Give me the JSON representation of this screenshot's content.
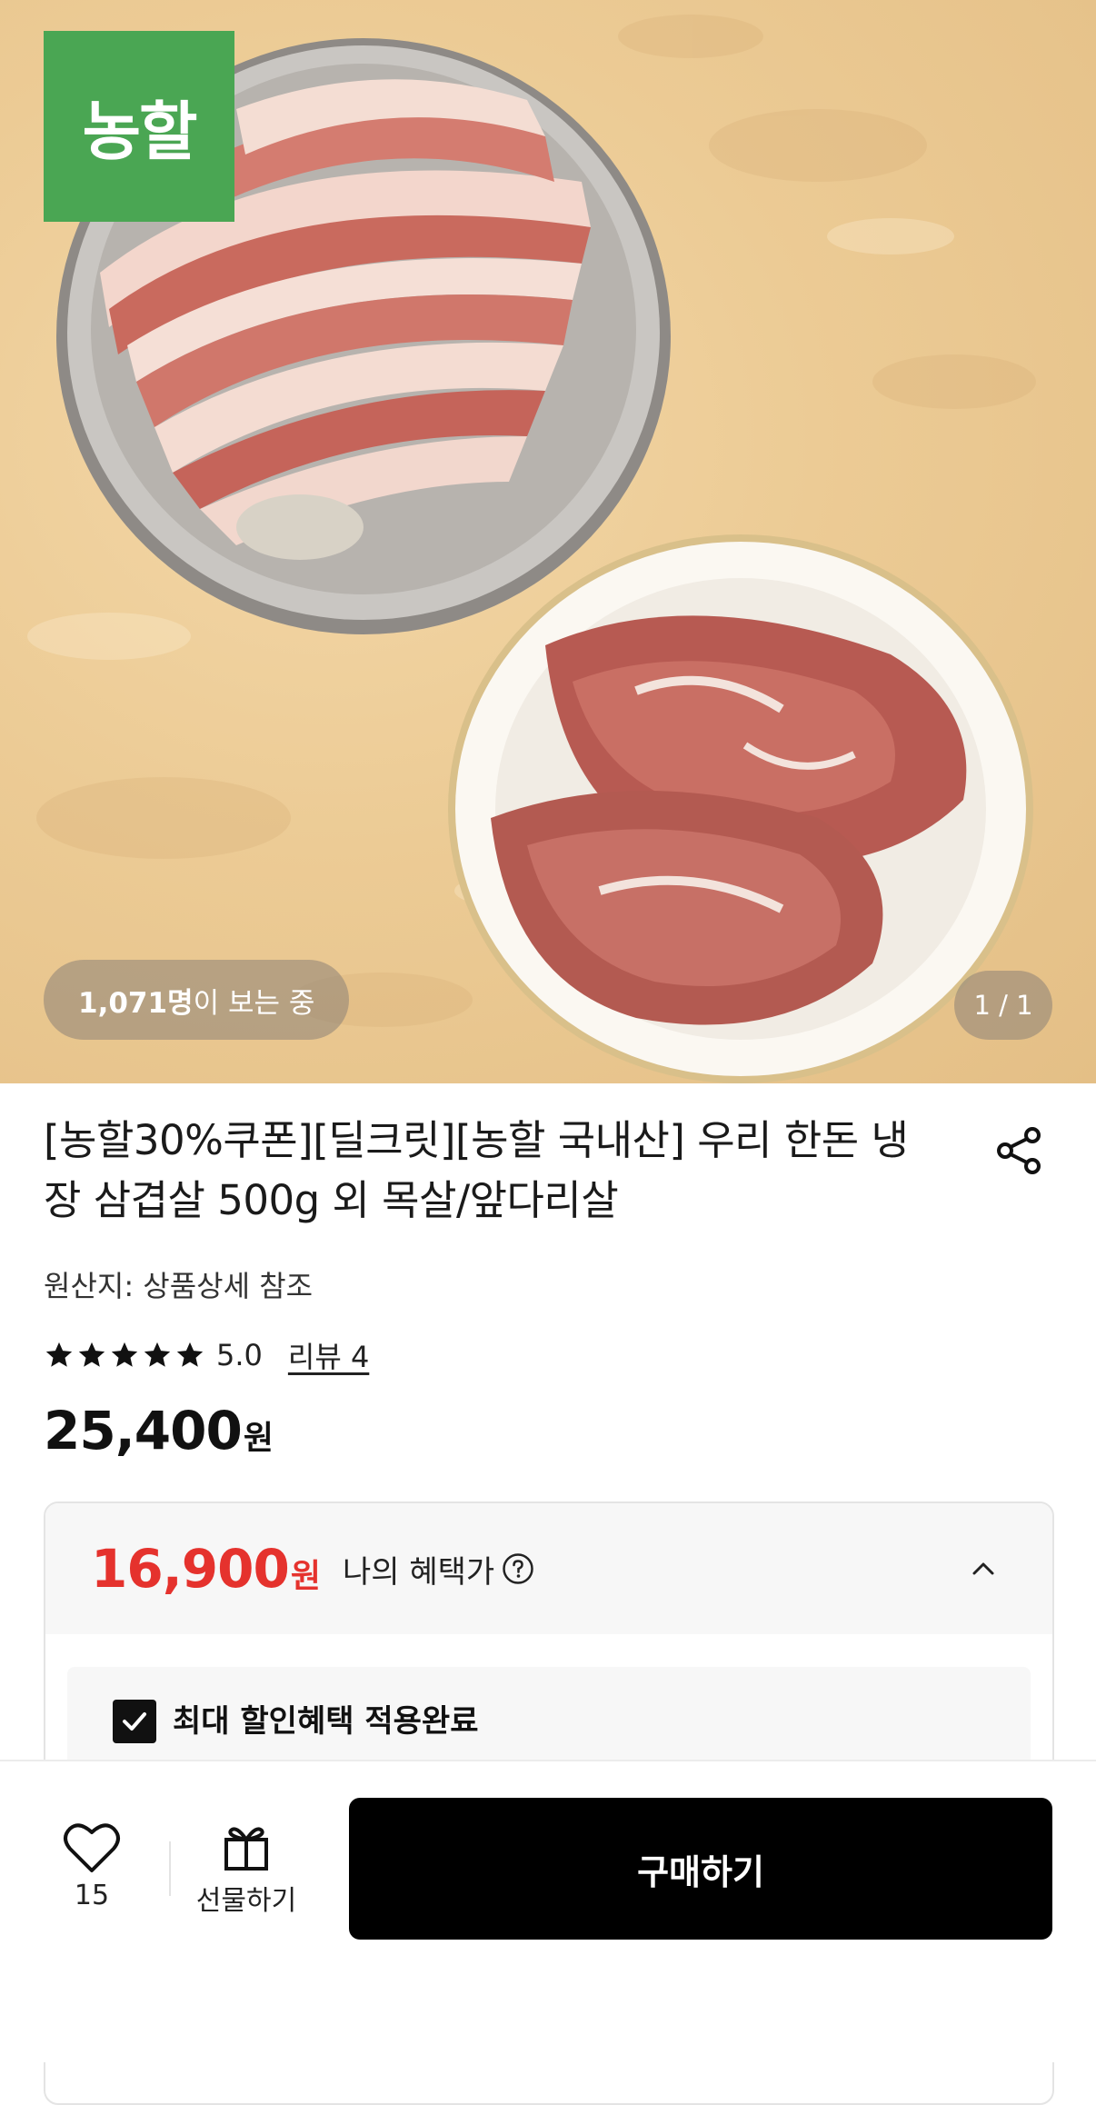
{
  "hero": {
    "brand_logo_text": "농할",
    "viewers": {
      "count": "1,071명",
      "suffix": "이 보는 중"
    },
    "image_counter": "1 / 1"
  },
  "product": {
    "title": "[농할30%쿠폰][딜크릿][농할 국내산] 우리 한돈 냉장 삼겹살 500g 외 목살/앞다리살",
    "origin": "원산지: 상품상세 참조",
    "rating": "5.0",
    "stars": 5,
    "review_link": "리뷰 4",
    "price": {
      "amount": "25,400",
      "unit": "원"
    }
  },
  "benefit": {
    "price": {
      "amount": "16,900",
      "unit": "원"
    },
    "label": "나의 혜택가",
    "applied_label": "최대 할인혜택 적용완료",
    "applied_checked": true
  },
  "bottom_bar": {
    "wish_count": "15",
    "gift_label": "선물하기",
    "buy_label": "구매하기"
  },
  "colors": {
    "brand_green": "#4aa653",
    "benefit_red": "#e5322d",
    "buy_button": "#000000"
  },
  "icons": {
    "share": "share-icon",
    "star": "star-icon",
    "help": "question-circle-icon",
    "collapse": "chevron-up-icon",
    "check": "check-icon",
    "wish": "heart-icon",
    "gift": "gift-icon"
  }
}
